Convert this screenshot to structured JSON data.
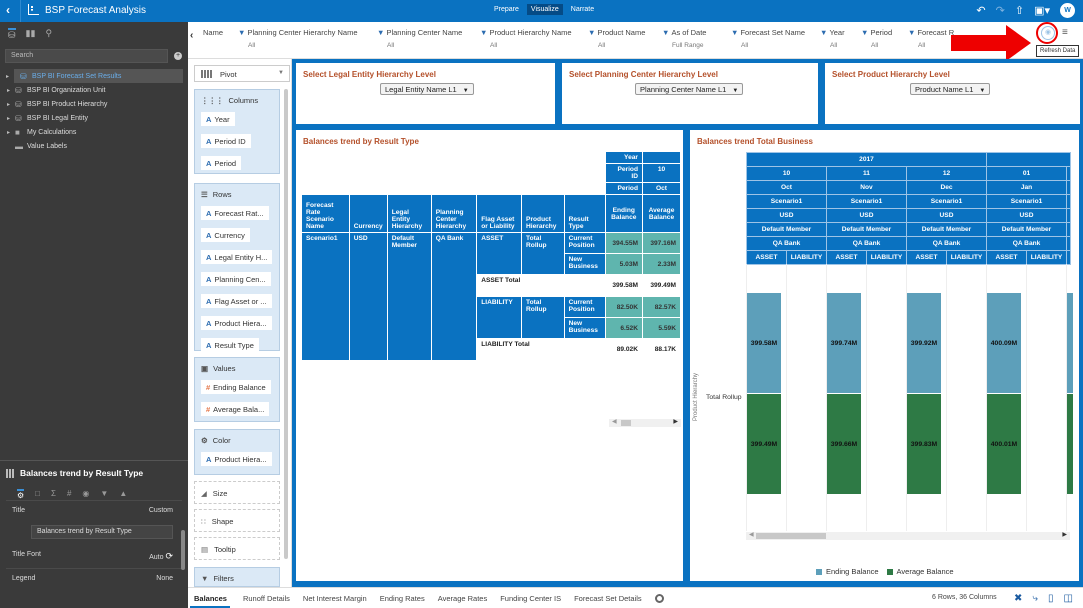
{
  "app": {
    "title": "BSP Forecast Analysis",
    "modes": [
      "Prepare",
      "Visualize",
      "Narrate"
    ],
    "active_mode": "Visualize",
    "user_initial": "W",
    "toolbar_icons": [
      "undo-icon",
      "redo-icon",
      "export-icon",
      "save-icon",
      "user-avatar"
    ]
  },
  "data_panel": {
    "tabs": [
      "data-icon",
      "visualizations-icon",
      "analytics-icon"
    ],
    "search_placeholder": "Search",
    "items": [
      {
        "label": "BSP BI Forecast Set Results",
        "icon": "database-icon",
        "selected": true
      },
      {
        "label": "BSP BI Organization Unit",
        "icon": "database-icon"
      },
      {
        "label": "BSP BI Product Hierarchy",
        "icon": "database-icon"
      },
      {
        "label": "BSP BI Legal Entity",
        "icon": "database-icon"
      },
      {
        "label": "My Calculations",
        "icon": "folder-icon"
      },
      {
        "label": "Value Labels",
        "icon": "tag-icon"
      }
    ]
  },
  "properties": {
    "viz_title": "Balances trend by Result Type",
    "tabs": [
      "general-icon",
      "axis-icon",
      "sigma-icon",
      "number-icon",
      "analytics-icon",
      "filter-icon",
      "warning-icon"
    ],
    "rows": [
      {
        "label": "Title",
        "value": "Custom"
      },
      {
        "label": "Title Font",
        "value": "Auto"
      },
      {
        "label": "Legend",
        "value": "None"
      }
    ],
    "title_input": "Balances trend by Result Type"
  },
  "filters": [
    {
      "label": "Name",
      "value": ""
    },
    {
      "label": "Planning Center Hierarchy Name",
      "value": "All"
    },
    {
      "label": "Planning Center Name",
      "value": "All"
    },
    {
      "label": "Product Hierarchy Name",
      "value": "All"
    },
    {
      "label": "Product Name",
      "value": "All"
    },
    {
      "label": "As of Date",
      "value": "Full Range"
    },
    {
      "label": "Forecast Set Name",
      "value": "All"
    },
    {
      "label": "Year",
      "value": "All"
    },
    {
      "label": "Period",
      "value": "All"
    },
    {
      "label": "Forecast R",
      "value": "All"
    }
  ],
  "refresh_tooltip": "Refresh Data",
  "grammar": {
    "viz_type": "Pivot",
    "columns_label": "Columns",
    "columns": [
      "Year",
      "Period ID",
      "Period"
    ],
    "rows_label": "Rows",
    "rows": [
      "Forecast Rat...",
      "Currency",
      "Legal Entity H...",
      "Planning Cen...",
      "Flag Asset or ...",
      "Product Hiera...",
      "Result Type"
    ],
    "values_label": "Values",
    "values": [
      "Ending Balance",
      "Average Bala..."
    ],
    "color_label": "Color",
    "color": [
      "Product Hiera..."
    ],
    "size_label": "Size",
    "shape_label": "Shape",
    "tooltip_label": "Tooltip",
    "filters_label": "Filters"
  },
  "selectors": [
    {
      "title": "Select Legal Entity Hierarchy Level",
      "value": "Legal Entity Name L1"
    },
    {
      "title": "Select Planning Center Hierarchy Level",
      "value": "Planning Center Name L1"
    },
    {
      "title": "Select Product Hierarchy Level",
      "value": "Product Name L1"
    }
  ],
  "pivot": {
    "title": "Balances trend by Result Type",
    "col_headers": {
      "year_label": "Year",
      "year_value": "",
      "period_id_label": "Period ID",
      "period_id_value": "10",
      "period_label": "Period",
      "period_value": "Oct"
    },
    "row_headers": [
      "Forecast Rate Scenario Name",
      "Currency",
      "Legal Entity Hierarchy",
      "Planning Center Hierarchy",
      "Flag Asset or Liability",
      "Product Hierarchy",
      "Result Type",
      "Ending Balance",
      "Average Balance"
    ],
    "scenario": "Scenario1",
    "currency": "USD",
    "legal_entity": "Default Member",
    "planning_center": "QA Bank",
    "groups": [
      {
        "flag": "ASSET",
        "product": "Total Rollup",
        "rows": [
          {
            "result_type": "Current Position",
            "ending": "394.55M",
            "average": "397.16M"
          },
          {
            "result_type": "New Business",
            "ending": "5.03M",
            "average": "2.33M"
          }
        ],
        "total_label": "ASSET Total",
        "total_ending": "399.58M",
        "total_average": "399.49M"
      },
      {
        "flag": "LIABILITY",
        "product": "Total Rollup",
        "rows": [
          {
            "result_type": "Current Position",
            "ending": "82.50K",
            "average": "82.57K"
          },
          {
            "result_type": "New Business",
            "ending": "6.52K",
            "average": "5.59K"
          }
        ],
        "total_label": "LIABILITY Total",
        "total_ending": "89.02K",
        "total_average": "88.17K"
      }
    ]
  },
  "trend": {
    "title": "Balances trend Total Business",
    "year": "2017",
    "periods": [
      {
        "id": "10",
        "name": "Oct"
      },
      {
        "id": "11",
        "name": "Nov"
      },
      {
        "id": "12",
        "name": "Dec"
      },
      {
        "id": "01",
        "name": "Jan"
      }
    ],
    "scenario": "Scenario1",
    "currency": "USD",
    "legal_entity": "Default Member",
    "planning_center": "QA Bank",
    "flags": [
      "ASSET",
      "LIABILITY"
    ],
    "row_axis_label": "Product Hierarchy",
    "row_label": "Total Rollup",
    "legend": [
      {
        "label": "Ending Balance",
        "color": "#5d9fba"
      },
      {
        "label": "Average Balance",
        "color": "#2e7a45"
      }
    ]
  },
  "chart_data": {
    "type": "bar",
    "title": "Balances trend Total Business",
    "categories": [
      "2017 10 Oct ASSET",
      "2017 11 Nov ASSET",
      "2017 12 Dec ASSET",
      "2017 01 Jan ASSET"
    ],
    "series": [
      {
        "name": "Ending Balance",
        "values": [
          399.58,
          399.74,
          399.92,
          400.09
        ],
        "labels": [
          "399.58M",
          "399.74M",
          "399.92M",
          "400.09M"
        ],
        "color": "#5d9fba"
      },
      {
        "name": "Average Balance",
        "values": [
          399.49,
          399.66,
          399.83,
          400.01
        ],
        "labels": [
          "399.49M",
          "399.66M",
          "399.83M",
          "400.01M"
        ],
        "color": "#2e7a45"
      }
    ],
    "units": "M",
    "xlabel": "",
    "ylabel": "Product Hierarchy",
    "legend_position": "bottom"
  },
  "bottom": {
    "tabs": [
      "Balances",
      "Runoff Details",
      "Net Interest Margin",
      "Ending Rates",
      "Average Rates",
      "Funding Center IS",
      "Forecast Set Details"
    ],
    "active_tab": "Balances",
    "status": "6 Rows, 36 Columns"
  }
}
